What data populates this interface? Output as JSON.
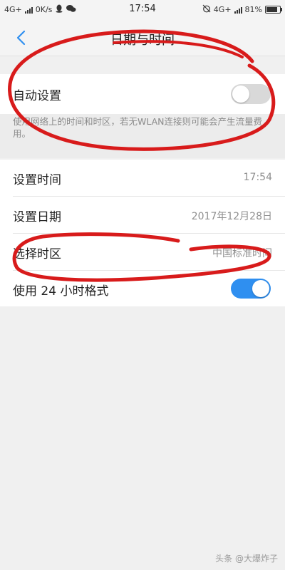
{
  "status_bar": {
    "left_network": "4G+",
    "speed": "0K/s",
    "time": "17:54",
    "right_network": "4G+",
    "battery_percent": "81%",
    "battery_level": 0.81
  },
  "header": {
    "title": "日期与时间"
  },
  "auto_setting": {
    "label": "自动设置",
    "enabled": false
  },
  "description": "使用网络上的时间和时区，若无WLAN连接则可能会产生流量费用。",
  "rows": [
    {
      "label": "设置时间",
      "value": "17:54"
    },
    {
      "label": "设置日期",
      "value": "2017年12月28日"
    },
    {
      "label": "选择时区",
      "value": "中国标准时间"
    },
    {
      "label": "使用 24 小时格式",
      "enabled": true
    }
  ],
  "watermark": "头条 @大爆炸子",
  "colors": {
    "accent": "#2f8ff0",
    "annotation": "#d81b1b"
  }
}
